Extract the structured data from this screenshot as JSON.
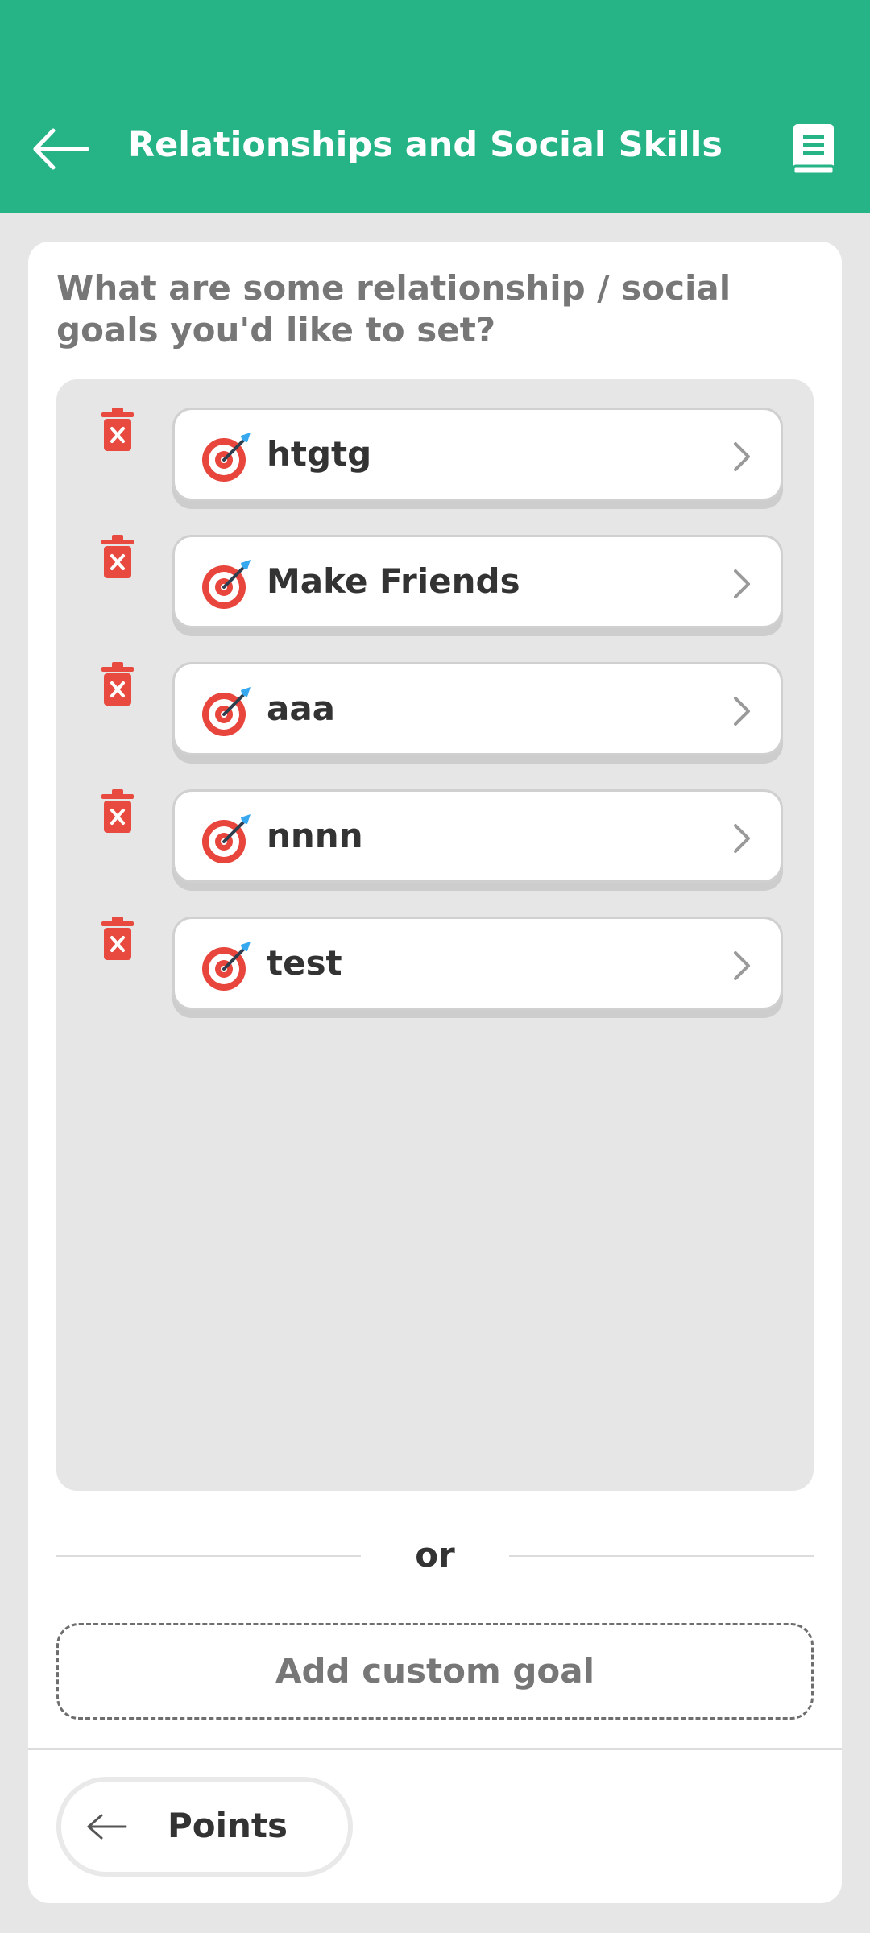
{
  "header": {
    "title": "Relationships and Social Skills",
    "back_icon": "arrow-left-icon",
    "book_icon": "book-icon",
    "background": "#26b386"
  },
  "prompt": {
    "question": "What are some relationship / social goals you'd like to set?"
  },
  "goals": [
    {
      "label": "htgtg"
    },
    {
      "label": "Make Friends"
    },
    {
      "label": "aaa"
    },
    {
      "label": "nnnn"
    },
    {
      "label": "test"
    }
  ],
  "goal_icon": "target-dart-icon",
  "delete_icon": "trash-icon",
  "delete_color": "#e84a3f",
  "divider": {
    "text": "or"
  },
  "add_custom": {
    "label": "Add custom goal"
  },
  "footer": {
    "points_label": "Points",
    "points_icon": "arrow-left-icon"
  }
}
